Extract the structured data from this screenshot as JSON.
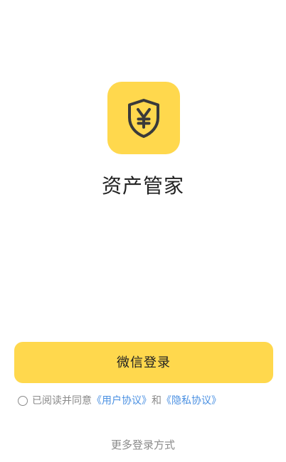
{
  "app": {
    "name": "资产管家",
    "icon": "shield-yen-icon",
    "accent_color": "#FFD84D"
  },
  "login": {
    "wechat_button_label": "微信登录"
  },
  "agreement": {
    "prefix": "已阅读并同意",
    "user_agreement": "《用户协议》",
    "connector": "和",
    "privacy_policy": "《隐私协议》",
    "checked": false
  },
  "more_login": {
    "label": "更多登录方式"
  }
}
